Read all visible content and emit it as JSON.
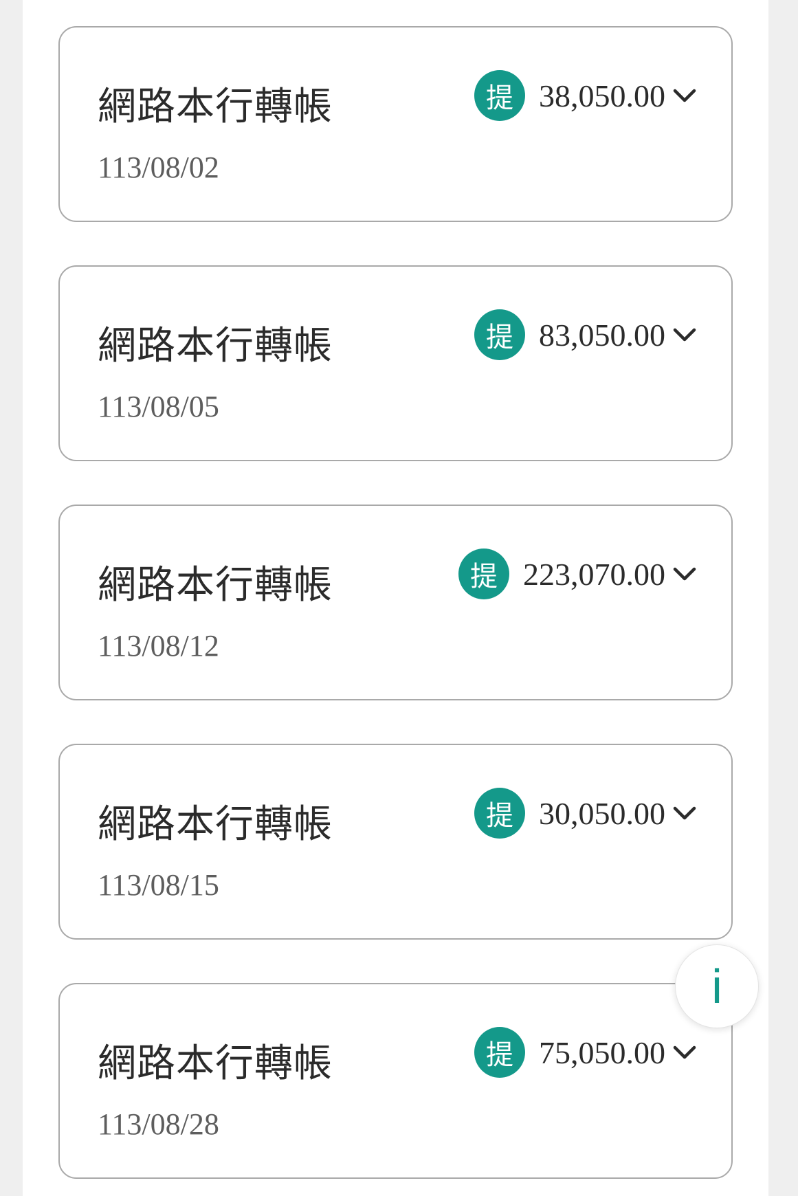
{
  "transactions": [
    {
      "title": "網路本行轉帳",
      "badge": "提",
      "amount": "38,050.00",
      "date": "113/08/02"
    },
    {
      "title": "網路本行轉帳",
      "badge": "提",
      "amount": "83,050.00",
      "date": "113/08/05"
    },
    {
      "title": "網路本行轉帳",
      "badge": "提",
      "amount": "223,070.00",
      "date": "113/08/12"
    },
    {
      "title": "網路本行轉帳",
      "badge": "提",
      "amount": "30,050.00",
      "date": "113/08/15"
    },
    {
      "title": "網路本行轉帳",
      "badge": "提",
      "amount": "75,050.00",
      "date": "113/08/28"
    }
  ],
  "icons": {
    "expand": "chevron-down-icon",
    "info": "info-icon"
  },
  "info_button": {
    "label": "i"
  },
  "colors": {
    "accent": "#14998a",
    "card_border": "#a9a9a9",
    "background": "#efefef"
  }
}
